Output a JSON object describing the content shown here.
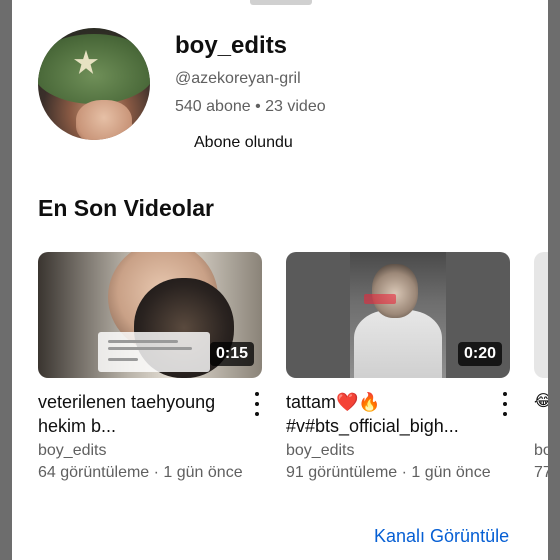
{
  "channel": {
    "name": "boy_edits",
    "handle": "@azekoreyan-gril",
    "stats": "540 abone • 23 video",
    "subscribed_label": "Abone olundu"
  },
  "section": {
    "title": "En Son Videolar"
  },
  "videos": [
    {
      "title": "veterilenen taehyoung  hekim b...",
      "channel": "boy_edits",
      "meta": "64 görüntüleme · 1 gün önce",
      "duration": "0:15",
      "overlay_text": "Başarılı gelememeyeceğiz. Alisimizda ölmeyeceğiz. Yüzüne tıklama bıktım bak sevimli"
    },
    {
      "title": "tattam❤️🔥 #v#bts_official_bigh...",
      "channel": "boy_edits",
      "meta": "91 görüntüleme · 1 gün önce",
      "duration": "0:20",
      "watermark": "@kulaksvr.gtmn"
    },
    {
      "title": "😂",
      "channel": "bo",
      "meta": "77"
    }
  ],
  "footer": {
    "view_channel_label": "Kanalı Görüntüle"
  },
  "icons": {
    "more": "more-vert-icon"
  }
}
